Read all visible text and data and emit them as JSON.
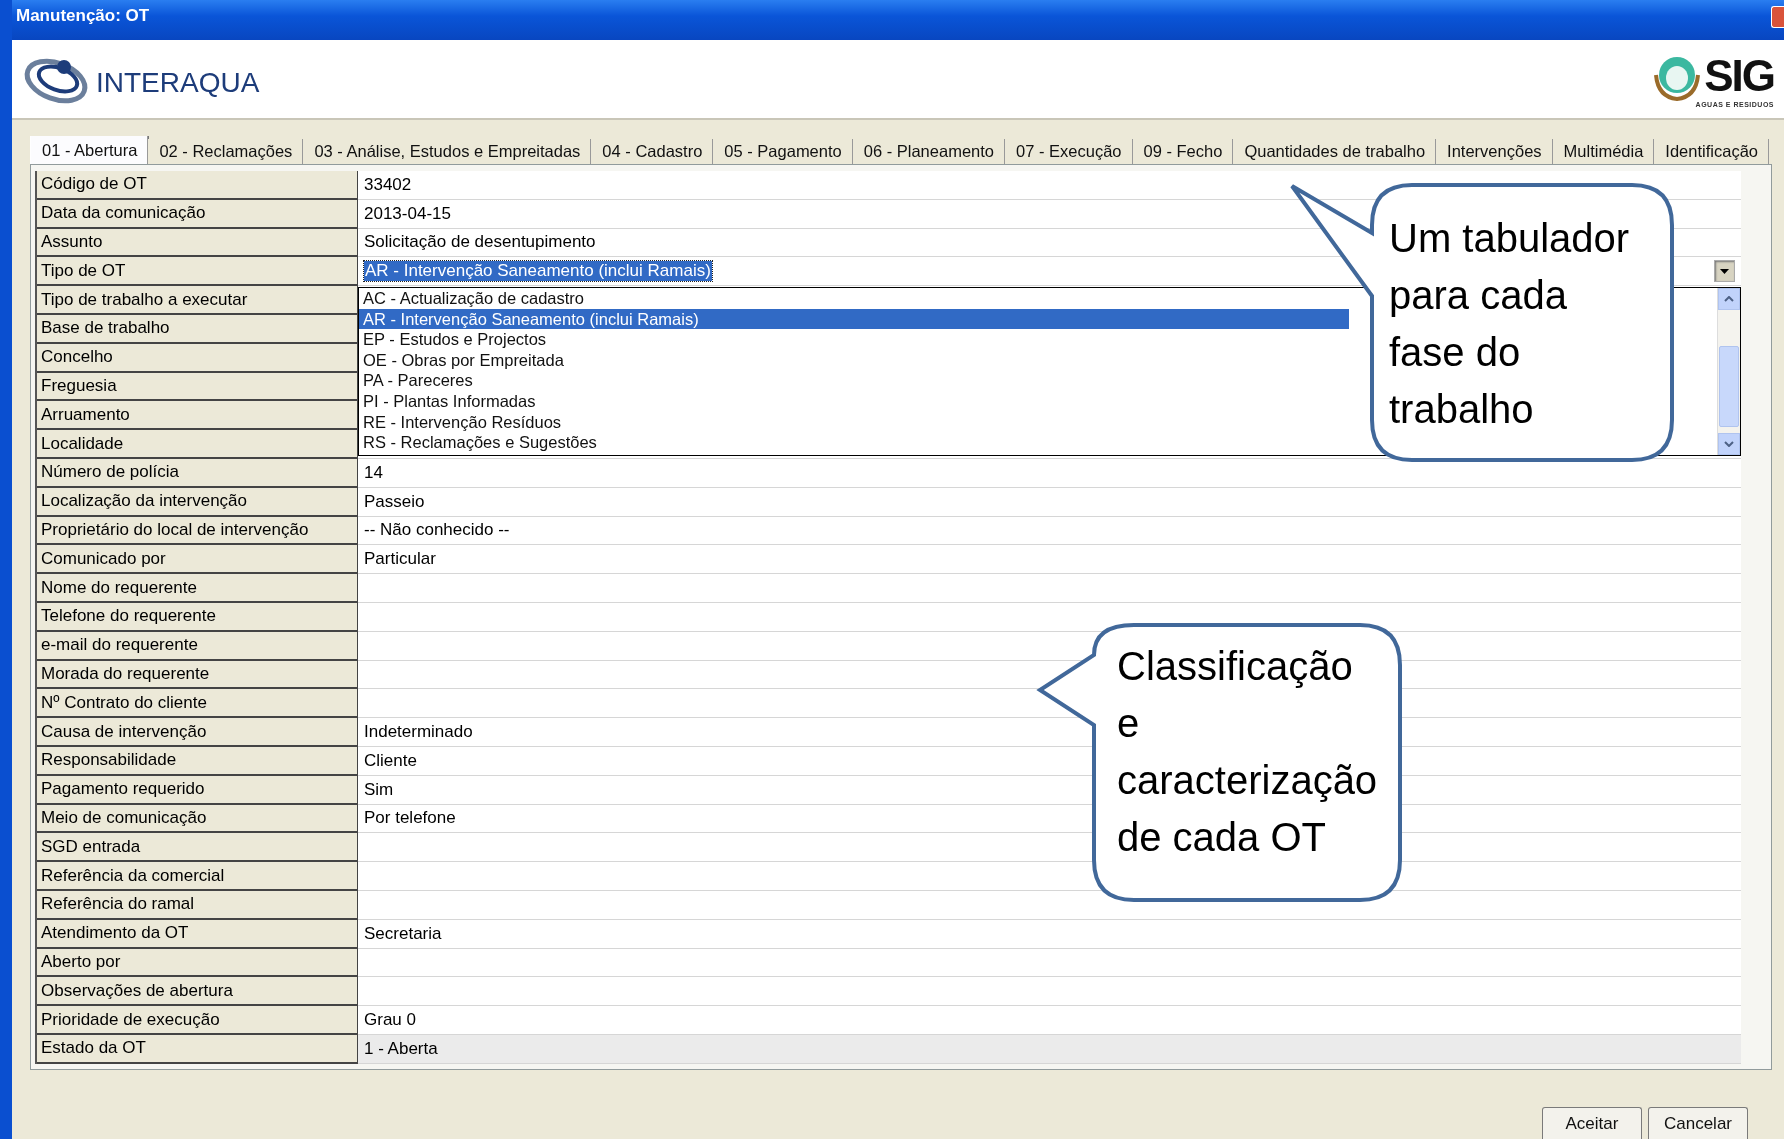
{
  "window": {
    "title": "Manutenção: OT"
  },
  "header": {
    "left_logo": "INTERAQUA",
    "right_logo": {
      "name": "SIG",
      "tagline": "AGUAS E RESIDUOS"
    }
  },
  "tabs": [
    {
      "label": "01 - Abertura",
      "selected": true
    },
    {
      "label": "02 - Reclamações",
      "selected": false
    },
    {
      "label": "03 - Análise, Estudos e Empreitadas",
      "selected": false
    },
    {
      "label": "04 - Cadastro",
      "selected": false
    },
    {
      "label": "05 - Pagamento",
      "selected": false
    },
    {
      "label": "06 - Planeamento",
      "selected": false
    },
    {
      "label": "07 - Execução",
      "selected": false
    },
    {
      "label": "09 - Fecho",
      "selected": false
    },
    {
      "label": "Quantidades de trabalho",
      "selected": false
    },
    {
      "label": "Intervenções",
      "selected": false
    },
    {
      "label": "Multimédia",
      "selected": false
    },
    {
      "label": "Identificação",
      "selected": false
    }
  ],
  "fields": [
    {
      "label": "Código de OT",
      "value": "33402",
      "kind": "text"
    },
    {
      "label": "Data da comunicação",
      "value": "2013-04-15",
      "kind": "text"
    },
    {
      "label": "Assunto",
      "value": "Solicitação de desentupimento",
      "kind": "text"
    },
    {
      "label": "Tipo de OT",
      "value": "AR - Intervenção Saneamento (inclui Ramais)",
      "kind": "combo",
      "expanded": true,
      "options": [
        {
          "label": "AC - Actualização de cadastro",
          "selected": false
        },
        {
          "label": "AR - Intervenção Saneamento (inclui Ramais)",
          "selected": true
        },
        {
          "label": "EP - Estudos e Projectos",
          "selected": false
        },
        {
          "label": "OE - Obras por Empreitada",
          "selected": false
        },
        {
          "label": "PA - Pareceres",
          "selected": false
        },
        {
          "label": "PI - Plantas Informadas",
          "selected": false
        },
        {
          "label": "RE - Intervenção Resíduos",
          "selected": false
        },
        {
          "label": "RS - Reclamações e Sugestões",
          "selected": false
        }
      ]
    },
    {
      "label": "Tipo de trabalho a executar",
      "kind": "text"
    },
    {
      "label": "Base de trabalho",
      "kind": "text"
    },
    {
      "label": "Concelho",
      "kind": "text"
    },
    {
      "label": "Freguesia",
      "kind": "text"
    },
    {
      "label": "Arruamento",
      "kind": "text"
    },
    {
      "label": "Localidade",
      "kind": "text"
    },
    {
      "label": "Número de polícia",
      "value": "14",
      "kind": "text"
    },
    {
      "label": "Localização da intervenção",
      "value": "Passeio",
      "kind": "text"
    },
    {
      "label": "Proprietário do local de intervenção",
      "value": "-- Não conhecido --",
      "kind": "text"
    },
    {
      "label": "Comunicado por",
      "value": "Particular",
      "kind": "text"
    },
    {
      "label": "Nome do requerente",
      "kind": "text"
    },
    {
      "label": "Telefone do requerente",
      "kind": "text"
    },
    {
      "label": "e-mail do requerente",
      "kind": "text"
    },
    {
      "label": "Morada do requerente",
      "kind": "text"
    },
    {
      "label": "Nº Contrato do cliente",
      "kind": "text"
    },
    {
      "label": "Causa de intervenção",
      "value": "Indeterminado",
      "kind": "text"
    },
    {
      "label": "Responsabilidade",
      "value": "Cliente",
      "kind": "text"
    },
    {
      "label": "Pagamento requerido",
      "value": "Sim",
      "kind": "text"
    },
    {
      "label": "Meio de comunicação",
      "value": "Por telefone",
      "kind": "text"
    },
    {
      "label": "SGD entrada",
      "kind": "text"
    },
    {
      "label": "Referência da comercial",
      "kind": "text"
    },
    {
      "label": "Referência do ramal",
      "kind": "text"
    },
    {
      "label": "Atendimento da OT",
      "value": "Secretaria",
      "kind": "text"
    },
    {
      "label": "Aberto  por",
      "kind": "text"
    },
    {
      "label": "Observações de abertura",
      "kind": "text"
    },
    {
      "label": "Prioridade de execução",
      "value": "Grau 0",
      "kind": "text"
    },
    {
      "label": "Estado da OT",
      "value": "1 - Aberta",
      "kind": "readonly"
    }
  ],
  "callouts": [
    "Um tabulador para cada fase do trabalho",
    "Classificação e caracterização de cada OT"
  ],
  "buttons": [
    "Aceitar",
    "Cancelar"
  ]
}
